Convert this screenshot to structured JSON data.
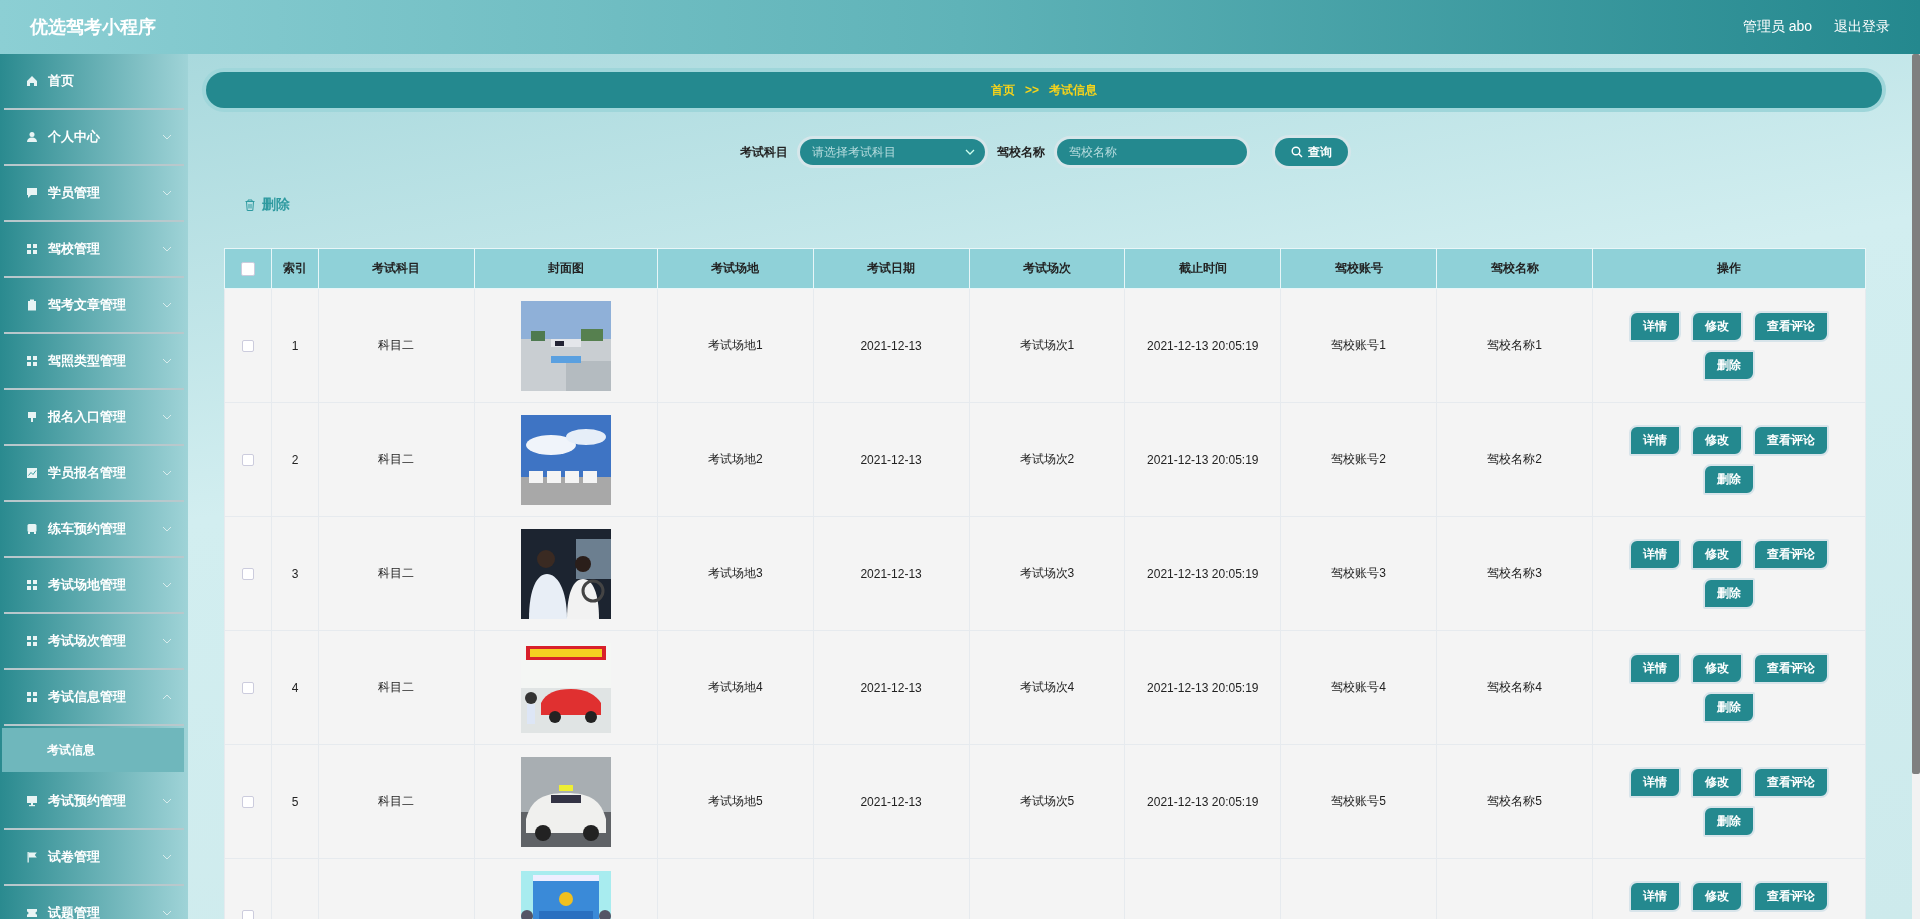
{
  "header": {
    "title": "优选驾考小程序",
    "user": "管理员 abo",
    "logout": "退出登录"
  },
  "sidebar": {
    "items": [
      {
        "label": "首页"
      },
      {
        "label": "个人中心",
        "expanded": false
      },
      {
        "label": "学员管理",
        "expanded": false
      },
      {
        "label": "驾校管理",
        "expanded": false
      },
      {
        "label": "驾考文章管理",
        "expanded": false
      },
      {
        "label": "驾照类型管理",
        "expanded": false
      },
      {
        "label": "报名入口管理",
        "expanded": false
      },
      {
        "label": "学员报名管理",
        "expanded": false
      },
      {
        "label": "练车预约管理",
        "expanded": false
      },
      {
        "label": "考试场地管理",
        "expanded": false
      },
      {
        "label": "考试场次管理",
        "expanded": false
      },
      {
        "label": "考试信息管理",
        "expanded": true,
        "children": [
          {
            "label": "考试信息",
            "selected": true
          }
        ]
      },
      {
        "label": "考试预约管理",
        "expanded": false
      },
      {
        "label": "试卷管理",
        "expanded": false
      },
      {
        "label": "试题管理",
        "expanded": false
      }
    ]
  },
  "breadcrumb": [
    "首页",
    ">>",
    "考试信息"
  ],
  "search": {
    "subject_label": "考试科目",
    "subject_placeholder": "请选择考试科目",
    "school_label": "驾校名称",
    "school_placeholder": "驾校名称",
    "button": "查询"
  },
  "delete_action": "删除",
  "table": {
    "select_all": {
      "checked": false
    },
    "columns": [
      "索引",
      "考试科目",
      "封面图",
      "考试场地",
      "考试日期",
      "考试场次",
      "截止时间",
      "驾校账号",
      "驾校名称",
      "操作"
    ],
    "rows": [
      {
        "checked": false,
        "cells": [
          "1",
          "科目二",
          {
            "kind": "picture"
          },
          "考试场地1",
          "2021-12-13",
          "考试场次1",
          "2021-12-13 20:05:19",
          "驾校账号1",
          "驾校名称1"
        ],
        "actions": [
          "详情",
          "修改",
          "查看评论",
          "删除"
        ]
      },
      {
        "checked": false,
        "cells": [
          "2",
          "科目二",
          {
            "kind": "picture"
          },
          "考试场地2",
          "2021-12-13",
          "考试场次2",
          "2021-12-13 20:05:19",
          "驾校账号2",
          "驾校名称2"
        ],
        "actions": [
          "详情",
          "修改",
          "查看评论",
          "删除"
        ]
      },
      {
        "checked": false,
        "cells": [
          "3",
          "科目二",
          {
            "kind": "picture"
          },
          "考试场地3",
          "2021-12-13",
          "考试场次3",
          "2021-12-13 20:05:19",
          "驾校账号3",
          "驾校名称3"
        ],
        "actions": [
          "详情",
          "修改",
          "查看评论",
          "删除"
        ]
      },
      {
        "checked": false,
        "cells": [
          "4",
          "科目二",
          {
            "kind": "picture"
          },
          "考试场地4",
          "2021-12-13",
          "考试场次4",
          "2021-12-13 20:05:19",
          "驾校账号4",
          "驾校名称4"
        ],
        "actions": [
          "详情",
          "修改",
          "查看评论",
          "删除"
        ]
      },
      {
        "checked": false,
        "cells": [
          "5",
          "科目二",
          {
            "kind": "picture"
          },
          "考试场地5",
          "2021-12-13",
          "考试场次5",
          "2021-12-13 20:05:19",
          "驾校账号5",
          "驾校名称5"
        ],
        "actions": [
          "详情",
          "修改",
          "查看评论",
          "删除"
        ]
      },
      {
        "checked": false,
        "cells": [
          null,
          null,
          {
            "kind": "picture"
          },
          null,
          null,
          null,
          null,
          null,
          null
        ],
        "actions": [
          "详情",
          "修改",
          "查看评论"
        ]
      }
    ]
  }
}
